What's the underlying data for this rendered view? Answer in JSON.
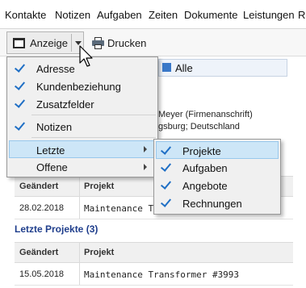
{
  "menubar": {
    "items": [
      "Kontakte",
      "Notizen",
      "Aufgaben",
      "Zeiten",
      "Dokumente",
      "Leistungen",
      "Re"
    ]
  },
  "toolbar": {
    "anzeige_label": "Anzeige",
    "drucken_label": "Drucken"
  },
  "content": {
    "tab_alle_label": "Alle",
    "address_line1": "Meyer (Firmenanschrift)",
    "address_line2": "gsburg; Deutschland",
    "table1": {
      "headers": [
        "Geändert",
        "Projekt"
      ],
      "rows": [
        [
          "28.02.2018",
          "Maintenance Tra"
        ]
      ]
    },
    "section_title": "Letzte Projekte (3)",
    "table2": {
      "headers": [
        "Geändert",
        "Projekt"
      ],
      "rows": [
        [
          "15.05.2018",
          "Maintenance Transformer #3993"
        ]
      ]
    }
  },
  "anzeige_menu": {
    "items": [
      {
        "label": "Adresse",
        "checked": true
      },
      {
        "label": "Kundenbeziehung",
        "checked": true
      },
      {
        "label": "Zusatzfelder",
        "checked": true
      },
      {
        "label": "Notizen",
        "checked": true
      },
      {
        "label": "Letzte",
        "checked": false,
        "submenu": true,
        "highlighted": true
      },
      {
        "label": "Offene",
        "checked": false,
        "submenu": true
      }
    ]
  },
  "letzte_submenu": {
    "items": [
      {
        "label": "Projekte",
        "checked": true,
        "highlighted": true
      },
      {
        "label": "Aufgaben",
        "checked": true
      },
      {
        "label": "Angebote",
        "checked": true
      },
      {
        "label": "Rechnungen",
        "checked": true
      }
    ]
  },
  "colors": {
    "accent": "#1f6fc5",
    "highlight": "#cde6f7",
    "menu_bg": "#f0f0f0",
    "section_title": "#1f3e8c"
  }
}
